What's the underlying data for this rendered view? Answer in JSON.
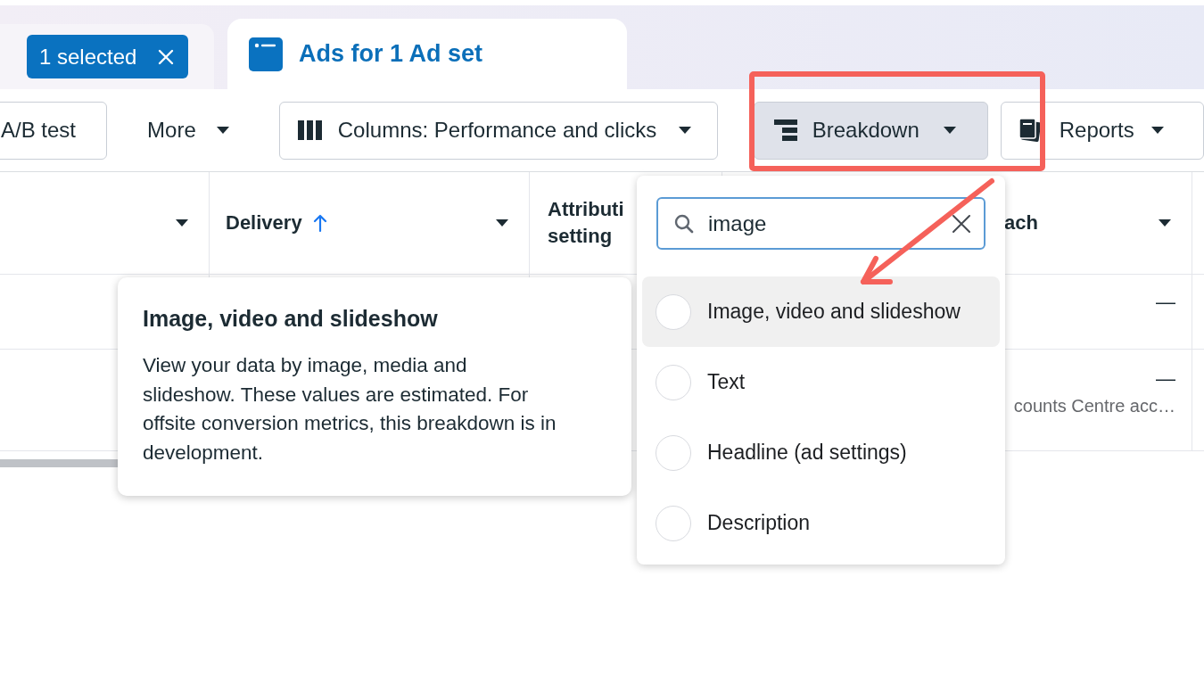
{
  "tabs": [
    {
      "kind": "selection",
      "label": "1 selected",
      "selected": false
    },
    {
      "kind": "title",
      "label": "Ads for 1 Ad set",
      "selected": true
    }
  ],
  "toolbar": {
    "buttons": [
      {
        "kind": "text",
        "label": "A/B test",
        "pressed": false
      },
      {
        "kind": "menu",
        "label": "More",
        "pressed": false
      },
      {
        "kind": "columns",
        "label": "Columns: Performance and clicks",
        "pressed": false
      },
      {
        "kind": "breakdown",
        "label": "Breakdown",
        "pressed": true
      },
      {
        "kind": "reports",
        "label": "Reports",
        "pressed": false
      }
    ]
  },
  "table": {
    "columns": [
      {
        "caret": true
      },
      {
        "label": "Delivery",
        "sorted": true,
        "caret": true
      },
      {
        "label": "Attributi",
        "label_2": "setting",
        "caret": false
      },
      {
        "label": "ach",
        "caret": true
      }
    ],
    "rows": [
      {
        "value": "—"
      },
      {
        "value": "—",
        "note": "counts Centre acc…"
      }
    ]
  },
  "tooltip": {
    "title": "Image, video and slideshow",
    "body": "View your data by image, media and slideshow. These values are estimated. For offsite conversion metrics, this breakdown is in development."
  },
  "dropdown": {
    "search": {
      "value": "image"
    },
    "options": [
      {
        "label": "Image, video and slideshow",
        "selected": false,
        "hovered": true
      },
      {
        "label": "Text",
        "selected": false,
        "hovered": false
      },
      {
        "label": "Headline (ad settings)",
        "selected": false,
        "hovered": false
      },
      {
        "label": "Description",
        "selected": false,
        "hovered": false
      }
    ]
  },
  "annotation": {
    "highlight_box": true,
    "arrow": true
  }
}
